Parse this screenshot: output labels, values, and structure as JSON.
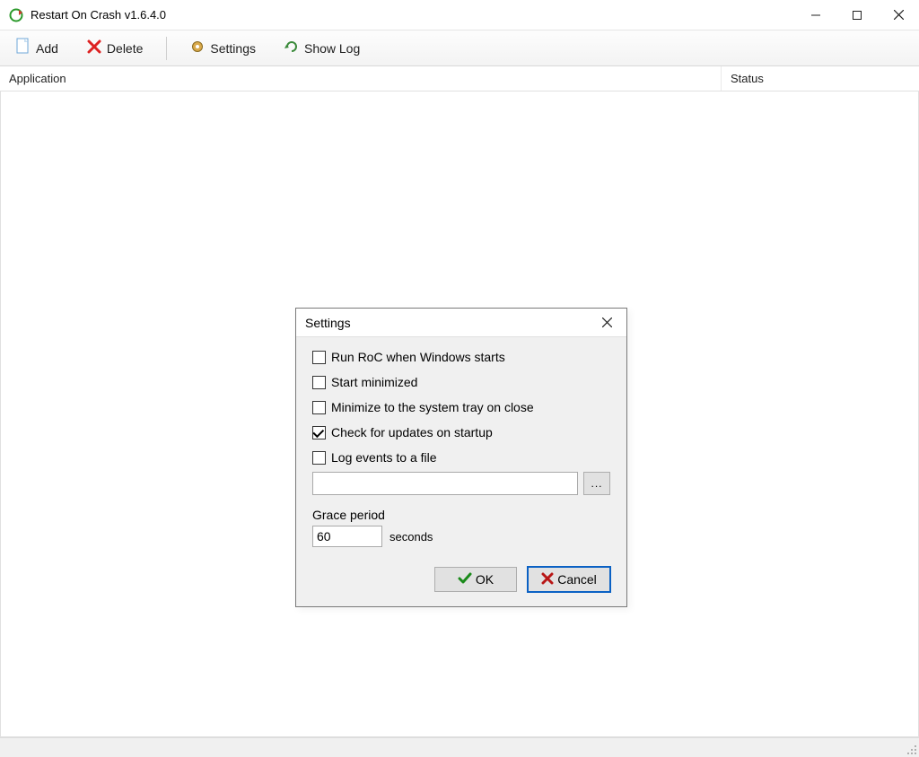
{
  "window": {
    "title": "Restart On Crash v1.6.4.0"
  },
  "toolbar": {
    "add_label": "Add",
    "delete_label": "Delete",
    "settings_label": "Settings",
    "showlog_label": "Show Log"
  },
  "columns": {
    "application": "Application",
    "status": "Status"
  },
  "dialog": {
    "title": "Settings",
    "options": {
      "run_on_start": {
        "label": "Run RoC when Windows starts",
        "checked": false
      },
      "start_minimized": {
        "label": "Start minimized",
        "checked": false
      },
      "minimize_tray": {
        "label": "Minimize to the system tray on close",
        "checked": false
      },
      "check_updates": {
        "label": "Check for updates on startup",
        "checked": true
      },
      "log_file": {
        "label": "Log events to a file",
        "checked": false
      }
    },
    "log_path": "",
    "browse_label": "...",
    "grace": {
      "label": "Grace period",
      "value": "60",
      "unit": "seconds"
    },
    "buttons": {
      "ok": "OK",
      "cancel": "Cancel"
    }
  }
}
